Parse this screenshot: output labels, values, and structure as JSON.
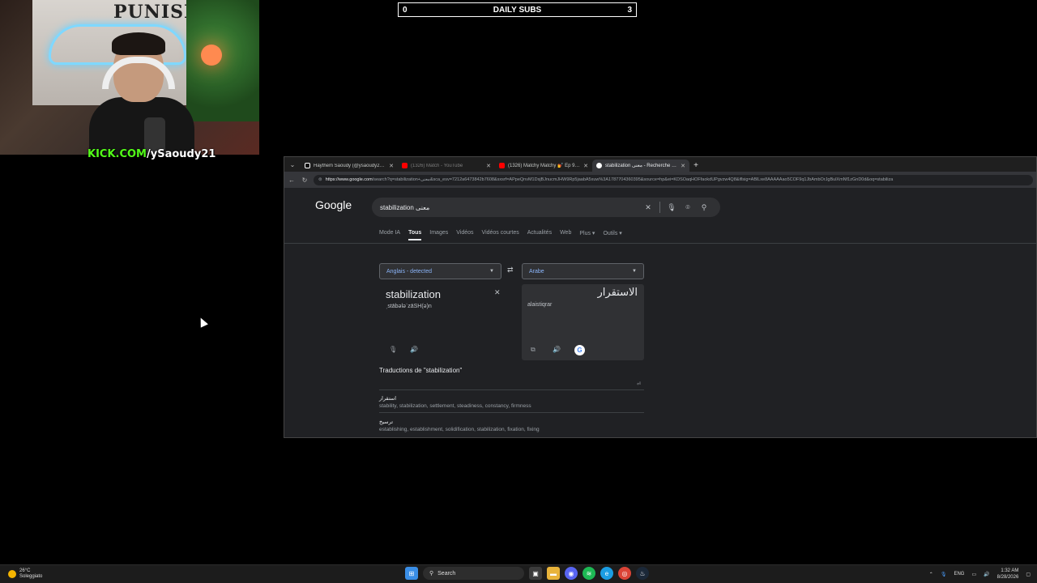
{
  "overlay": {
    "kick_prefix": "KICK.COM",
    "kick_handle": "/ySaoudy21",
    "cam_sign": "PUNISHER",
    "subs": {
      "left": "0",
      "title": "DAILY SUBS",
      "right": "3"
    }
  },
  "browser": {
    "tabs": [
      {
        "title": "Haythem Saoudy (@ysaoudy21) |",
        "state": "normal",
        "favicon_color": "#ffffff"
      },
      {
        "title": "(1326) Match - YouTube",
        "state": "dim",
        "favicon_color": "#ff0000"
      },
      {
        "title": "(1326) Matchy Matchy 💅 Ep 91 /",
        "state": "normal",
        "favicon_color": "#ff0000"
      },
      {
        "title": "stabilization معنى - Recherche Go",
        "state": "active",
        "favicon_color": "#ffffff"
      }
    ],
    "url_host": "https://www.google.com",
    "url_rest": "/search?q=stabilization+معنى&sca_esv=7212a6473842b7608&sxsrf=APpeQnvM1DsjBJnucmJHW9Rp5jaabA5xuw%3A1787704360395&source=hp&ei=KDSOaqHOFfaokdUPgvzw4Q8&iflsig=ABlLxe8AAAAAao5COF9q1JbAmbOrJgBulXmNf1zGnD0d&oq=stabiliza"
  },
  "google": {
    "logo": "Google",
    "query": "stabilization معنى",
    "tabs": [
      "Mode IA",
      "Tous",
      "Images",
      "Vidéos",
      "Vidéos courtes",
      "Actualités",
      "Web",
      "Plus ▾",
      "Outils ▾"
    ],
    "active_tab": "Tous",
    "source_lang": "Anglais - detected",
    "target_lang": "Arabe",
    "source_word": "stabilization",
    "source_phonetic": "ˌstābələˈzāSH(ə)n",
    "target_word": "الاستقرار",
    "target_romanization": "alaistiqrar",
    "translations_title": "Traductions de \"stabilization\"",
    "translations": [
      {
        "arabic": "استقرار",
        "english": "stability, stabilization, settlement, steadiness, constancy, firmness"
      },
      {
        "arabic": "ترسيخ",
        "english": "establishing, establishment, solidification, stabilization, fixation, fixing"
      }
    ]
  },
  "taskbar": {
    "weather_temp": "26°C",
    "weather_desc": "Soleggiato",
    "search_label": "Search",
    "lang": "ENG",
    "time": "1:32 AM",
    "date": "8/28/2026"
  }
}
